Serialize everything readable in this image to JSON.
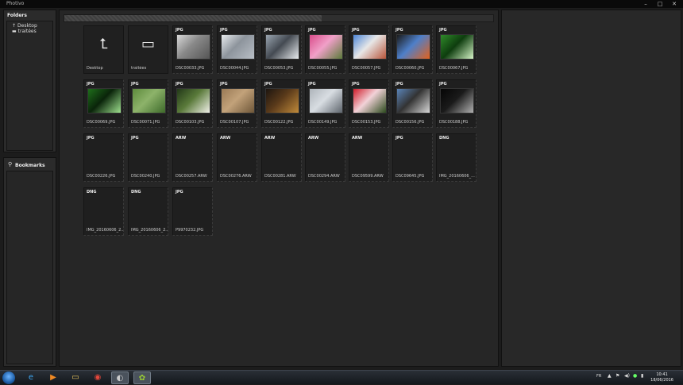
{
  "window": {
    "title": "Photivo",
    "min": "–",
    "max": "□",
    "close": "✕"
  },
  "folders_panel": {
    "title": "Folders",
    "items": [
      {
        "label": "Desktop",
        "icon": "up-arrow-icon"
      },
      {
        "label": "traitées",
        "icon": "folder-icon"
      }
    ]
  },
  "bookmarks_panel": {
    "title": "Bookmarks"
  },
  "path_progress": 0.6,
  "tiles": [
    {
      "type": "",
      "name": "Desktop",
      "kind": "up",
      "colors": []
    },
    {
      "type": "",
      "name": "traitées",
      "kind": "folder",
      "colors": []
    },
    {
      "type": "JPG",
      "name": "DSC00033.JPG",
      "kind": "photo",
      "colors": [
        "#d8d8d8",
        "#555555",
        "#888888"
      ]
    },
    {
      "type": "JPG",
      "name": "DSC00044.JPG",
      "kind": "photo",
      "colors": [
        "#e8ebee",
        "#b9bfc6",
        "#8d949c"
      ]
    },
    {
      "type": "JPG",
      "name": "DSC00053.JPG",
      "kind": "photo",
      "colors": [
        "#9aa5b0",
        "#e9ecef",
        "#444a52"
      ]
    },
    {
      "type": "JPG",
      "name": "DSC00055.JPG",
      "kind": "photo",
      "colors": [
        "#d94c8a",
        "#5b7a3a",
        "#f0a0c8"
      ]
    },
    {
      "type": "JPG",
      "name": "DSC00057.JPG",
      "kind": "photo",
      "colors": [
        "#4d86d6",
        "#b8553a",
        "#e7e7e7"
      ]
    },
    {
      "type": "JPG",
      "name": "DSC00060.JPG",
      "kind": "photo",
      "colors": [
        "#1b1b1b",
        "#e2621d",
        "#4e7fc9"
      ]
    },
    {
      "type": "JPG",
      "name": "DSC00067.JPG",
      "kind": "photo",
      "colors": [
        "#2f8a2a",
        "#d6f5c7",
        "#0e3d0e"
      ]
    },
    {
      "type": "JPG",
      "name": "DSC00069.JPG",
      "kind": "photo",
      "colors": [
        "#1f6f1b",
        "#9ee08e",
        "#0a240a"
      ]
    },
    {
      "type": "JPG",
      "name": "DSC00071.JPG",
      "kind": "photo",
      "colors": [
        "#5d8a3c",
        "#3e6a2a",
        "#8db36a"
      ]
    },
    {
      "type": "JPG",
      "name": "DSC00103.JPG",
      "kind": "photo",
      "colors": [
        "#223818",
        "#f0f0e8",
        "#5a7a3a"
      ]
    },
    {
      "type": "JPG",
      "name": "DSC00107.JPG",
      "kind": "photo",
      "colors": [
        "#9a7a55",
        "#6e5638",
        "#c2a27a"
      ]
    },
    {
      "type": "JPG",
      "name": "DSC00122.JPG",
      "kind": "photo",
      "colors": [
        "#1d1510",
        "#c08a3a",
        "#5a3a1a"
      ]
    },
    {
      "type": "JPG",
      "name": "DSC00149.JPG",
      "kind": "photo",
      "colors": [
        "#aeb4ba",
        "#5d646c",
        "#d8dde2"
      ]
    },
    {
      "type": "JPG",
      "name": "DSC00153.JPG",
      "kind": "photo",
      "colors": [
        "#d01c2a",
        "#2b4a1c",
        "#f2d2d8"
      ]
    },
    {
      "type": "JPG",
      "name": "DSC00156.JPG",
      "kind": "photo",
      "colors": [
        "#5a84b8",
        "#d8d8d8",
        "#333333"
      ]
    },
    {
      "type": "JPG",
      "name": "DSC00188.JPG",
      "kind": "photo",
      "colors": [
        "#050505",
        "#b0b0b0",
        "#1a1a1a"
      ]
    },
    {
      "type": "JPG",
      "name": "DSC00226.JPG",
      "kind": "empty",
      "colors": []
    },
    {
      "type": "JPG",
      "name": "DSC00240.JPG",
      "kind": "empty",
      "colors": []
    },
    {
      "type": "ARW",
      "name": "DSC00257.ARW",
      "kind": "empty",
      "colors": []
    },
    {
      "type": "ARW",
      "name": "DSC00276.ARW",
      "kind": "empty",
      "colors": []
    },
    {
      "type": "ARW",
      "name": "DSC00281.ARW",
      "kind": "empty",
      "colors": []
    },
    {
      "type": "ARW",
      "name": "DSC00294.ARW",
      "kind": "empty",
      "colors": []
    },
    {
      "type": "ARW",
      "name": "DSC09599.ARW",
      "kind": "empty",
      "colors": []
    },
    {
      "type": "JPG",
      "name": "DSC09645.JPG",
      "kind": "empty",
      "colors": []
    },
    {
      "type": "DNG",
      "name": "IMG_20160606_...",
      "kind": "empty",
      "colors": []
    },
    {
      "type": "DNG",
      "name": "IMG_20160606_2...",
      "kind": "empty",
      "colors": []
    },
    {
      "type": "DNG",
      "name": "IMG_20160606_2...",
      "kind": "empty",
      "colors": []
    },
    {
      "type": "JPG",
      "name": "P9970232.JPG",
      "kind": "empty",
      "colors": []
    }
  ],
  "taskbar": {
    "apps": [
      {
        "name": "ie-icon",
        "glyph": "e",
        "color": "#3fa9f5"
      },
      {
        "name": "media-player-icon",
        "glyph": "▶",
        "color": "#f08a24"
      },
      {
        "name": "explorer-icon",
        "glyph": "▭",
        "color": "#e8c35a"
      },
      {
        "name": "chrome-icon",
        "glyph": "◉",
        "color": "#e5473b"
      },
      {
        "name": "photo-app-icon",
        "glyph": "◐",
        "color": "#cccccc"
      },
      {
        "name": "photivo-icon",
        "glyph": "✿",
        "color": "#9acd32"
      }
    ],
    "lang": "FR",
    "time": "10:41",
    "date": "18/06/2016"
  }
}
